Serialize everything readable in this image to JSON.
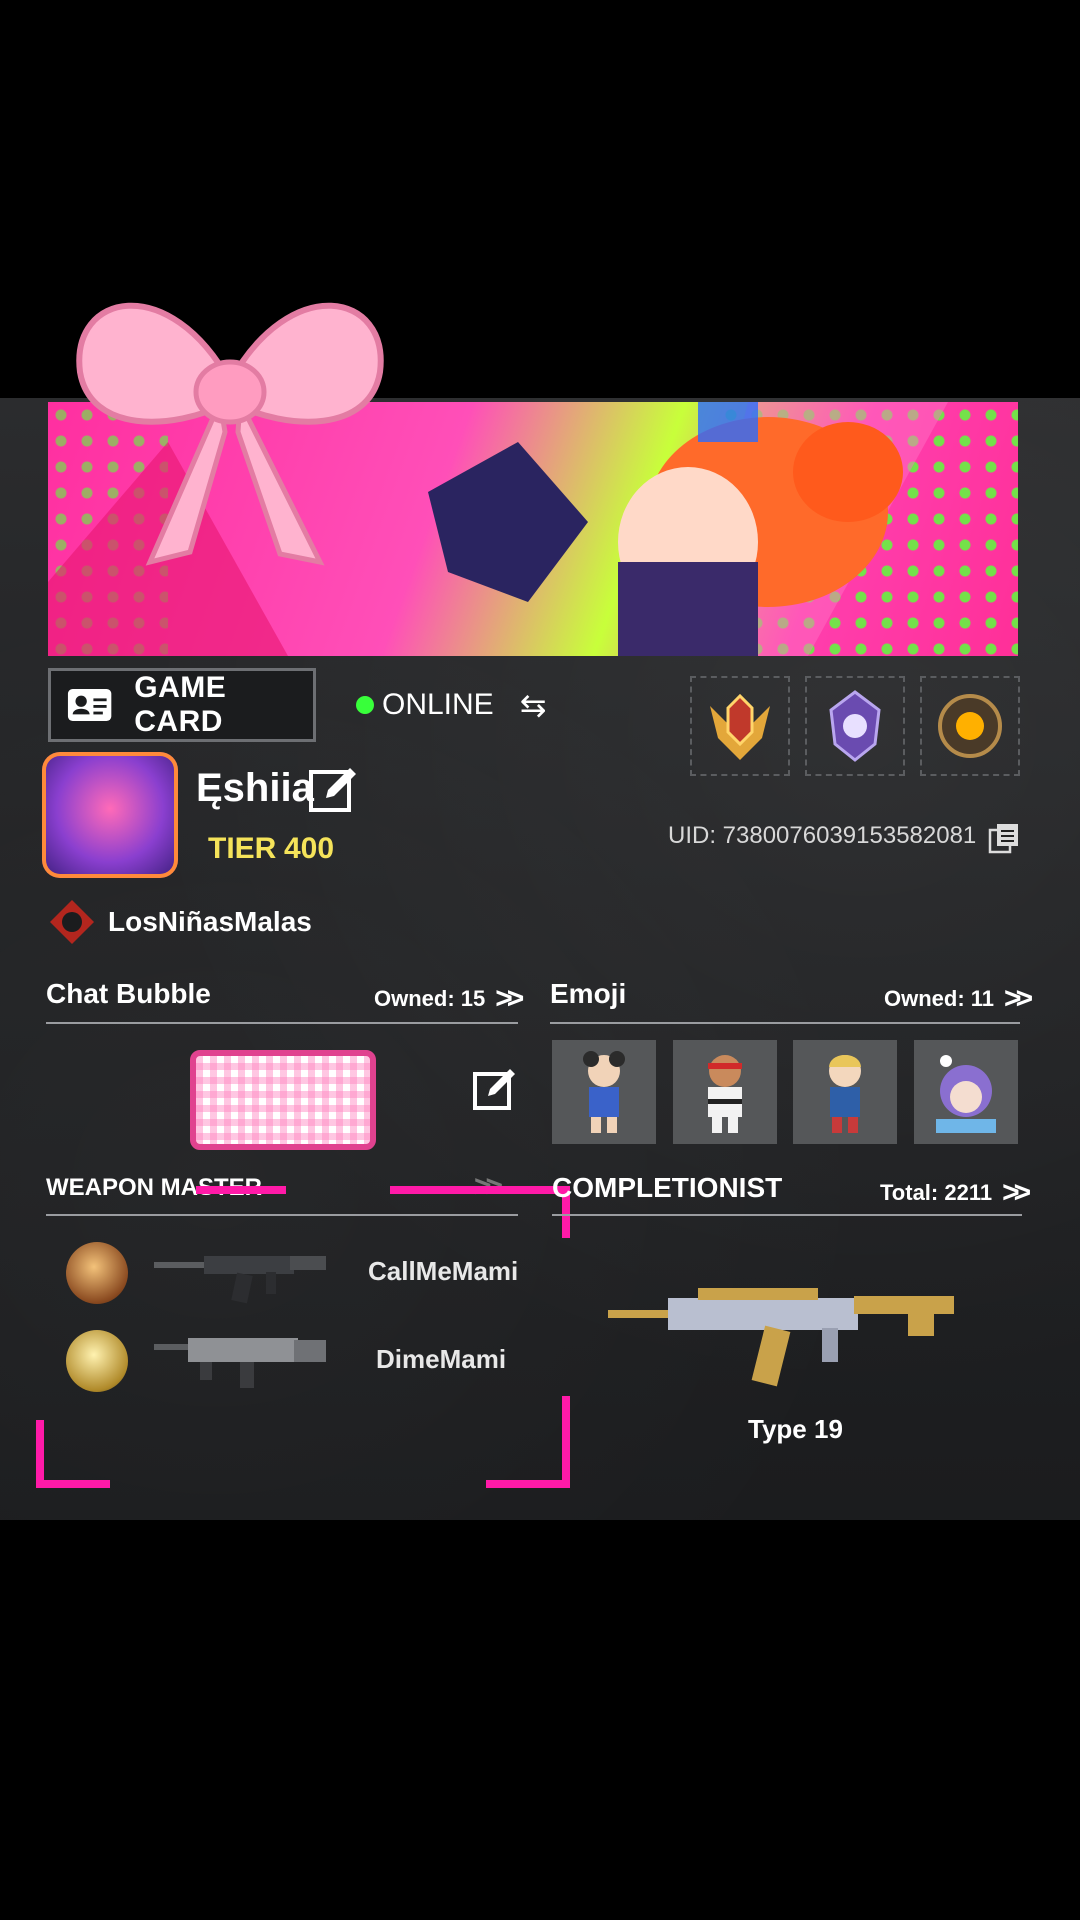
{
  "status": {
    "text": "ONLINE",
    "color": "#38ff3a"
  },
  "game_card": {
    "label": "GAME CARD"
  },
  "profile": {
    "name": "Ęshiia",
    "tier_label": "TIER",
    "tier_value": "400",
    "uid": "UID: 7380076039153582081",
    "clan": "LosNiñasMalas"
  },
  "chat_bubble": {
    "title": "Chat Bubble",
    "owned": "Owned: 15"
  },
  "emoji": {
    "title": "Emoji",
    "owned": "Owned: 11"
  },
  "weapon_master": {
    "title": "WEAPON MASTER",
    "rows": [
      {
        "name": "CallMeMami"
      },
      {
        "name": "DimeMami"
      }
    ]
  },
  "completionist": {
    "title": "COMPLETIONIST",
    "total": "Total: 2211",
    "weapon": "Type 19"
  },
  "colors": {
    "accent_pink": "#ff1aa8",
    "tier_yellow": "#f5e35a",
    "panel": "#242527"
  }
}
